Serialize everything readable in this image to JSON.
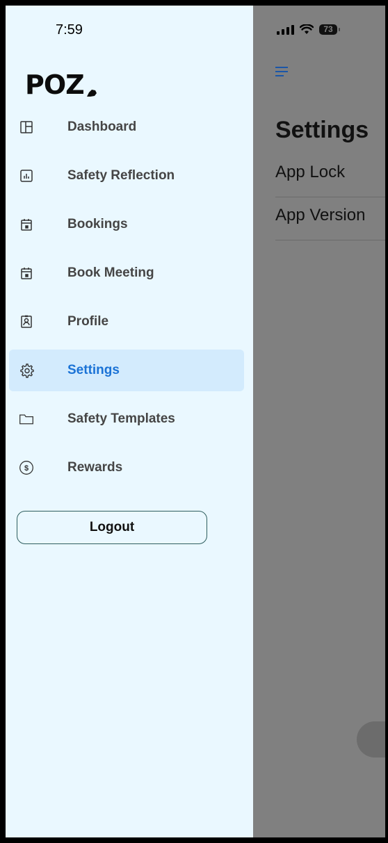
{
  "status_bar": {
    "time": "7:59",
    "battery": "73"
  },
  "background_page": {
    "title": "Settings",
    "rows": [
      "App Lock",
      "App Version"
    ]
  },
  "drawer": {
    "logo": "POZ",
    "menu": [
      {
        "label": "Dashboard",
        "icon": "dashboard-icon",
        "active": false
      },
      {
        "label": "Safety Reflection",
        "icon": "chart-icon",
        "active": false
      },
      {
        "label": "Bookings",
        "icon": "calendar-icon",
        "active": false
      },
      {
        "label": "Book Meeting",
        "icon": "calendar-icon",
        "active": false
      },
      {
        "label": "Profile",
        "icon": "profile-icon",
        "active": false
      },
      {
        "label": "Settings",
        "icon": "gear-icon",
        "active": true
      },
      {
        "label": "Safety Templates",
        "icon": "folder-icon",
        "active": false
      },
      {
        "label": "Rewards",
        "icon": "dollar-icon",
        "active": false
      }
    ],
    "logout_label": "Logout"
  },
  "colors": {
    "drawer_bg": "#eaf8ff",
    "active_bg": "#d3ebfd",
    "active_text": "#1b73d6",
    "overlay": "#808080"
  }
}
